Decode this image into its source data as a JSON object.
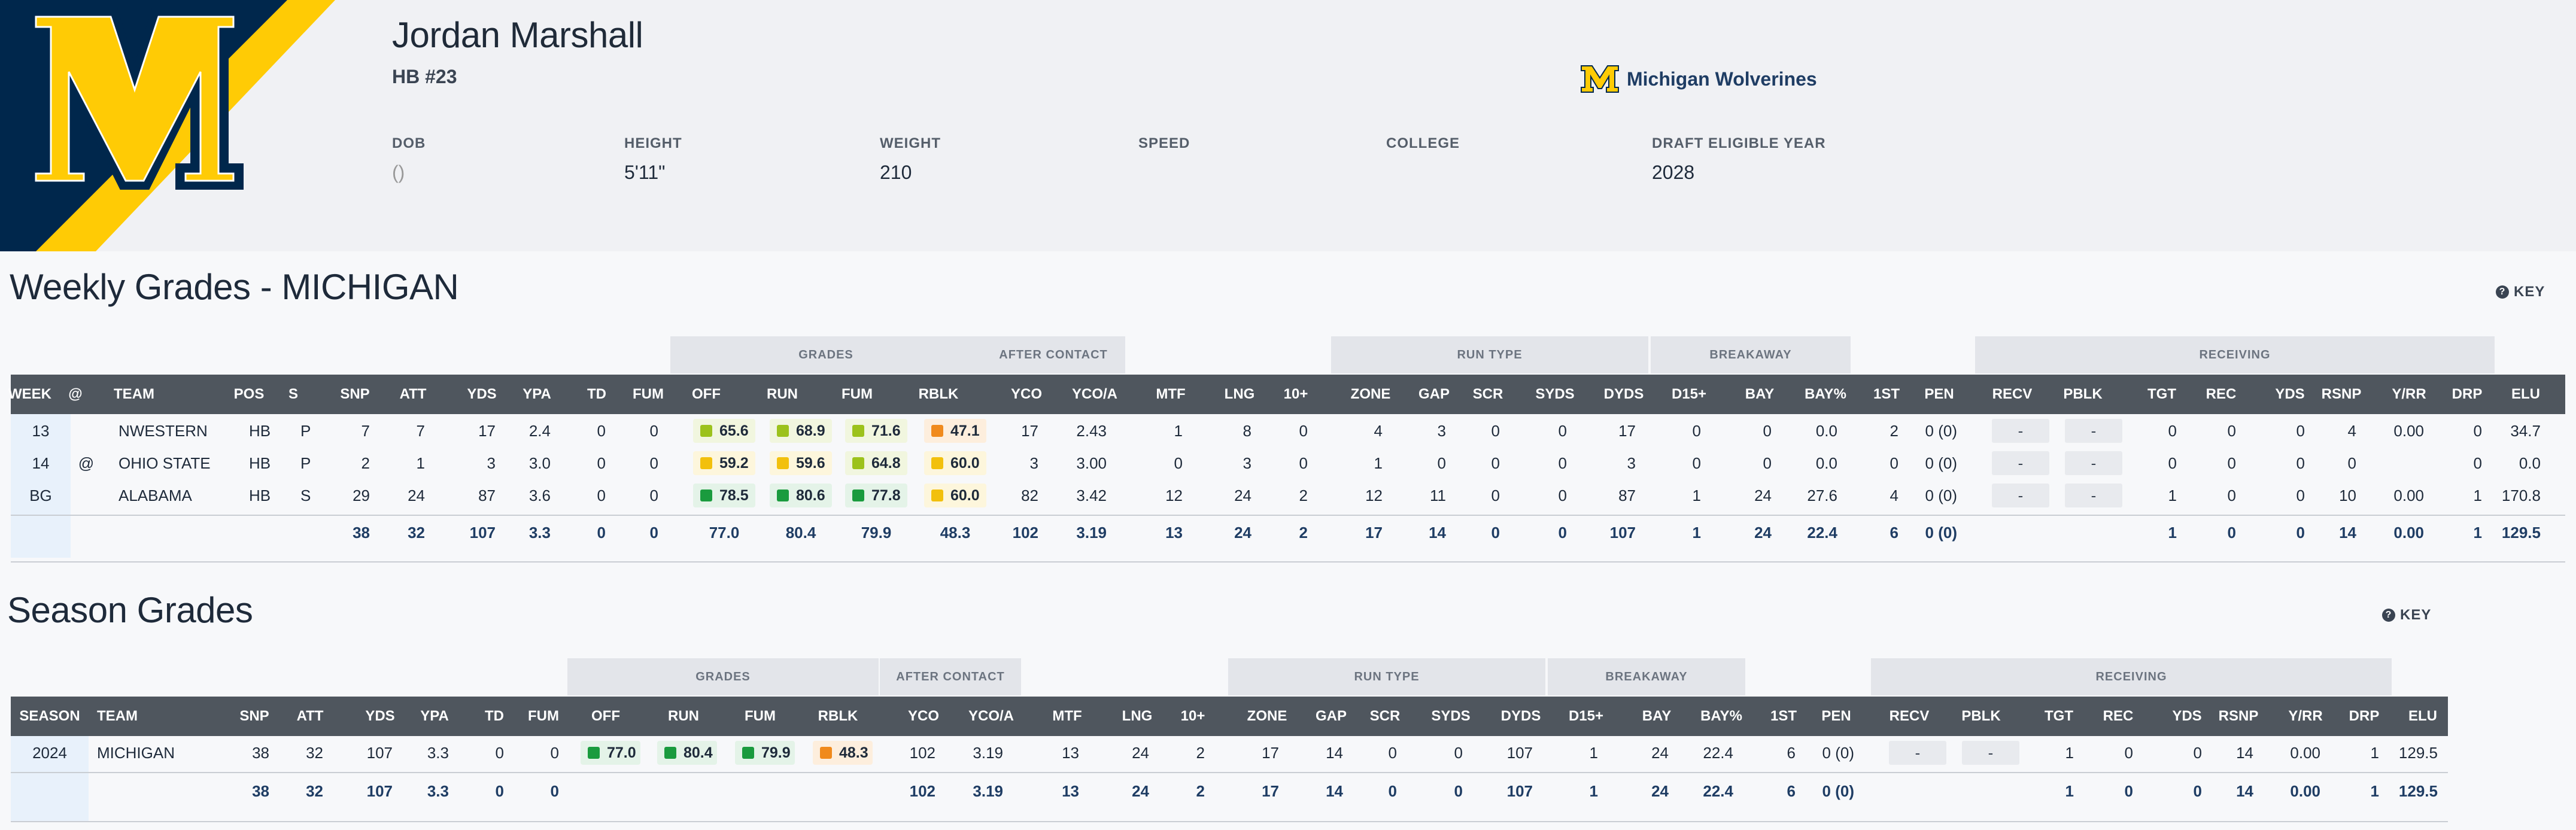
{
  "player": {
    "name": "Jordan Marshall",
    "position": "HB #23",
    "team": "Michigan Wolverines"
  },
  "info": [
    {
      "label": "DOB",
      "value": "()"
    },
    {
      "label": "HEIGHT",
      "value": "5'11\""
    },
    {
      "label": "WEIGHT",
      "value": "210"
    },
    {
      "label": "SPEED",
      "value": ""
    },
    {
      "label": "COLLEGE",
      "value": ""
    },
    {
      "label": "DRAFT ELIGIBLE YEAR",
      "value": "2028"
    }
  ],
  "colors": {
    "maize": "#ffcb05",
    "navy": "#00274c",
    "green": "#1a9b3e",
    "lime": "#9cc21c",
    "yellow": "#f2c00d",
    "orange": "#f08a1c",
    "header_bg": "#4f565e"
  },
  "weekly": {
    "title": "Weekly Grades - MICHIGAN",
    "key_label": "KEY",
    "groups": [
      "GRADES",
      "AFTER CONTACT",
      "RUN TYPE",
      "BREAKAWAY",
      "RECEIVING"
    ],
    "columns": [
      "WEEK",
      "@",
      "TEAM",
      "POS",
      "S",
      "SNP",
      "ATT",
      "YDS",
      "YPA",
      "TD",
      "FUM",
      "OFF",
      "RUN",
      "FUM",
      "RBLK",
      "YCO",
      "YCO/A",
      "MTF",
      "LNG",
      "10+",
      "ZONE",
      "GAP",
      "SCR",
      "SYDS",
      "DYDS",
      "D15+",
      "BAY",
      "BAY%",
      "1ST",
      "PEN",
      "RECV",
      "PBLK",
      "TGT",
      "REC",
      "YDS",
      "RSNP",
      "Y/RR",
      "DRP",
      "ELU"
    ],
    "rows": [
      {
        "week": "13",
        "at": "",
        "team": "NWESTERN",
        "pos": "HB",
        "s": "P",
        "snp": "7",
        "att": "7",
        "yds": "17",
        "ypa": "2.4",
        "td": "0",
        "fum": "0",
        "grades": [
          {
            "v": "65.6",
            "c": "lime"
          },
          {
            "v": "68.9",
            "c": "lime"
          },
          {
            "v": "71.6",
            "c": "lime"
          },
          {
            "v": "47.1",
            "c": "orange"
          }
        ],
        "rest": [
          "17",
          "2.43",
          "1",
          "8",
          "0",
          "4",
          "3",
          "0",
          "0",
          "17",
          "0",
          "0",
          "0.0",
          "2",
          "0 (0)"
        ],
        "recv": "-",
        "pblk": "-",
        "rec": [
          "0",
          "0",
          "0",
          "4",
          "0.00",
          "0",
          "34.7"
        ]
      },
      {
        "week": "14",
        "at": "@",
        "team": "OHIO STATE",
        "pos": "HB",
        "s": "P",
        "snp": "2",
        "att": "1",
        "yds": "3",
        "ypa": "3.0",
        "td": "0",
        "fum": "0",
        "grades": [
          {
            "v": "59.2",
            "c": "yellow"
          },
          {
            "v": "59.6",
            "c": "yellow"
          },
          {
            "v": "64.8",
            "c": "lime"
          },
          {
            "v": "60.0",
            "c": "yellow"
          }
        ],
        "rest": [
          "3",
          "3.00",
          "0",
          "3",
          "0",
          "1",
          "0",
          "0",
          "0",
          "3",
          "0",
          "0",
          "0.0",
          "0",
          "0 (0)"
        ],
        "recv": "-",
        "pblk": "-",
        "rec": [
          "0",
          "0",
          "0",
          "0",
          "",
          "0",
          "0.0"
        ]
      },
      {
        "week": "BG",
        "at": "",
        "team": "ALABAMA",
        "pos": "HB",
        "s": "S",
        "snp": "29",
        "att": "24",
        "yds": "87",
        "ypa": "3.6",
        "td": "0",
        "fum": "0",
        "grades": [
          {
            "v": "78.5",
            "c": "green"
          },
          {
            "v": "80.6",
            "c": "green"
          },
          {
            "v": "77.8",
            "c": "green"
          },
          {
            "v": "60.0",
            "c": "yellow"
          }
        ],
        "rest": [
          "82",
          "3.42",
          "12",
          "24",
          "2",
          "12",
          "11",
          "0",
          "0",
          "87",
          "1",
          "24",
          "27.6",
          "4",
          "0 (0)"
        ],
        "recv": "-",
        "pblk": "-",
        "rec": [
          "1",
          "0",
          "0",
          "10",
          "0.00",
          "1",
          "170.8"
        ]
      }
    ],
    "totals": {
      "snp": "38",
      "att": "32",
      "yds": "107",
      "ypa": "3.3",
      "td": "0",
      "fum": "0",
      "grades": [
        "77.0",
        "80.4",
        "79.9",
        "48.3"
      ],
      "rest": [
        "102",
        "3.19",
        "13",
        "24",
        "2",
        "17",
        "14",
        "0",
        "0",
        "107",
        "1",
        "24",
        "22.4",
        "6",
        "0 (0)"
      ],
      "rec": [
        "1",
        "0",
        "0",
        "14",
        "0.00",
        "1",
        "129.5"
      ]
    }
  },
  "season": {
    "title": "Season Grades",
    "key_label": "KEY",
    "groups": [
      "GRADES",
      "AFTER CONTACT",
      "RUN TYPE",
      "BREAKAWAY",
      "RECEIVING"
    ],
    "columns": [
      "SEASON",
      "TEAM",
      "SNP",
      "ATT",
      "YDS",
      "YPA",
      "TD",
      "FUM",
      "OFF",
      "RUN",
      "FUM",
      "RBLK",
      "YCO",
      "YCO/A",
      "MTF",
      "LNG",
      "10+",
      "ZONE",
      "GAP",
      "SCR",
      "SYDS",
      "DYDS",
      "D15+",
      "BAY",
      "BAY%",
      "1ST",
      "PEN",
      "RECV",
      "PBLK",
      "TGT",
      "REC",
      "YDS",
      "RSNP",
      "Y/RR",
      "DRP",
      "ELU"
    ],
    "row": {
      "season": "2024",
      "team": "MICHIGAN",
      "snp": "38",
      "att": "32",
      "yds": "107",
      "ypa": "3.3",
      "td": "0",
      "fum": "0",
      "grades": [
        {
          "v": "77.0",
          "c": "green"
        },
        {
          "v": "80.4",
          "c": "green"
        },
        {
          "v": "79.9",
          "c": "green"
        },
        {
          "v": "48.3",
          "c": "orange"
        }
      ],
      "rest": [
        "102",
        "3.19",
        "13",
        "24",
        "2",
        "17",
        "14",
        "0",
        "0",
        "107",
        "1",
        "24",
        "22.4",
        "6",
        "0 (0)"
      ],
      "recv": "-",
      "pblk": "-",
      "rec": [
        "1",
        "0",
        "0",
        "14",
        "0.00",
        "1",
        "129.5"
      ]
    },
    "totals": {
      "snp": "38",
      "att": "32",
      "yds": "107",
      "ypa": "3.3",
      "td": "0",
      "fum": "0",
      "rest": [
        "102",
        "3.19",
        "13",
        "24",
        "2",
        "17",
        "14",
        "0",
        "0",
        "107",
        "1",
        "24",
        "22.4",
        "6",
        "0 (0)"
      ],
      "rec": [
        "1",
        "0",
        "0",
        "14",
        "0.00",
        "1",
        "129.5"
      ]
    }
  }
}
